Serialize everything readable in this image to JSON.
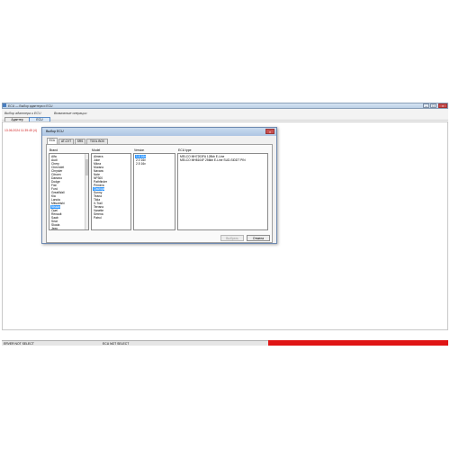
{
  "window": {
    "title": "ECU — Выбор адаптера и ECU",
    "btn_minimize": "–",
    "btn_maximize": "□",
    "btn_close": "×"
  },
  "menu": {
    "item1": "Выбор адаптера и ECU",
    "item2": "Возможные операции"
  },
  "toolbar": {
    "adapter_label": "Адаптер",
    "ecu_label": "ECU"
  },
  "log": {
    "line": "13.06.2024 11:39:45 (4)"
  },
  "dialog": {
    "title": "Выбор ECU",
    "close": "×",
    "tabs": [
      "ECU",
      "AT-CVT",
      "SRS",
      "TOOL BOX"
    ],
    "brand_header": "Brand",
    "model_header": "Model",
    "version_header": "Version",
    "ecutype_header": "ECU type",
    "brands": [
      "Alfa",
      "Audi",
      "Chery",
      "Chevrolet",
      "Chrysler",
      "Citroen",
      "Daewoo",
      "Dodge",
      "Fiat",
      "Ford",
      "GreatWall",
      "Kia",
      "Lancia",
      "Mitsubishi",
      "Nissan",
      "Opel",
      "Peugeot",
      "Renault",
      "Saab",
      "Seat",
      "Skoda",
      "Smart",
      "Suzuki",
      "Toyota",
      "Volvo",
      "Gazelle",
      "Lifan",
      "Geely",
      "Infiniti",
      "Jeep"
    ],
    "brands_visible": [
      "Alfa",
      "Audi",
      "Chery",
      "Chevrolet",
      "Chrysler",
      "Citroen",
      "Daewoo",
      "Dodge",
      "Fiat",
      "Ford",
      "GreatWall",
      "Kia",
      "Lancia",
      "Mitsubishi",
      "Nissan",
      "Opel",
      "Renault",
      "Saab",
      "Seat",
      "Skoda",
      "Jeep",
      "Kia"
    ],
    "brand_selected": "Nissan",
    "models": [
      "Almera",
      "Juke",
      "Micra",
      "Murano",
      "Navara",
      "Note",
      "NP300",
      "Pathfinder",
      "Primera",
      "Qashqai",
      "Sunny",
      "Teana",
      "Tiida",
      "X-Trail",
      "Terrano",
      "Vanette",
      "Serena",
      "Patrol"
    ],
    "model_selected": "Qashqai",
    "versions": [
      "1.6 16v",
      "2.0 16v",
      "2.5 16v"
    ],
    "version_selected": "1.6 16v",
    "ecu_types": [
      "MELCO MH7203FA 128kb E-Line",
      "MELCO MH8104F 256kb E-Line SUD-SIDDT PIN"
    ],
    "btn_select": "Выбрать",
    "btn_cancel": "Отмена"
  },
  "status": {
    "left": "ERVER NOT SELECT",
    "middle": "ECU NOT SELECT"
  },
  "colors": {
    "selection": "#3399ff",
    "status_error": "#e01515",
    "log_text": "#d02020"
  }
}
